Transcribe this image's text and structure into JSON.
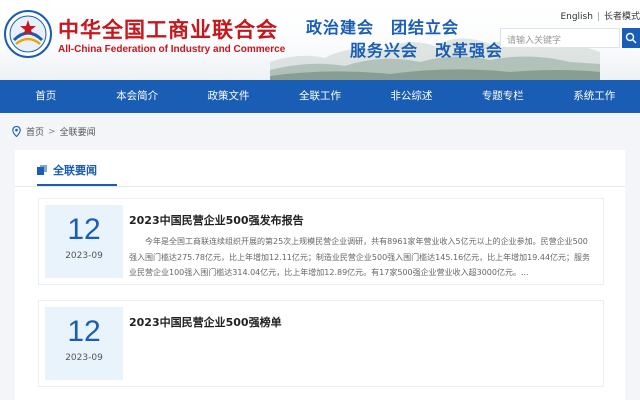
{
  "header": {
    "org_name_cn": "中华全国工商业联合会",
    "org_name_en": "All-China Federation of Industry and Commerce",
    "slogan_line1": "政治建会　团结立会",
    "slogan_line2": "服务兴会　改革强会",
    "top_links": [
      "English",
      "长者模式"
    ],
    "search_placeholder": "请输入关键字"
  },
  "nav": {
    "items": [
      "首页",
      "本会简介",
      "政策文件",
      "全联工作",
      "非公综述",
      "专题专栏",
      "系统工作"
    ]
  },
  "breadcrumb": {
    "home": "首页",
    "separator": ">",
    "current": "全联要闻"
  },
  "section": {
    "title": "全联要闻"
  },
  "news": [
    {
      "day": "12",
      "year_month": "2023-09",
      "title": "2023中国民营企业500强发布报告",
      "summary": "今年是全国工商联连续组织开展的第25次上规模民营企业调研，共有8961家年营业收入5亿元以上的企业参加。民营企业500强入围门槛达275.78亿元，比上年增加12.11亿元；制造业民营企业500强入围门槛达145.16亿元，比上年增加19.44亿元；服务业民营企业100强入围门槛达314.04亿元，比上年增加12.89亿元。有17家500强企业营业收入超3000亿元。..."
    },
    {
      "day": "12",
      "year_month": "2023-09",
      "title": "2023中国民营企业500强榜单",
      "summary": ""
    }
  ],
  "colors": {
    "brand_red": "#c8161d",
    "brand_blue": "#1a5db4",
    "date_box_bg": "#e9f3fc"
  }
}
